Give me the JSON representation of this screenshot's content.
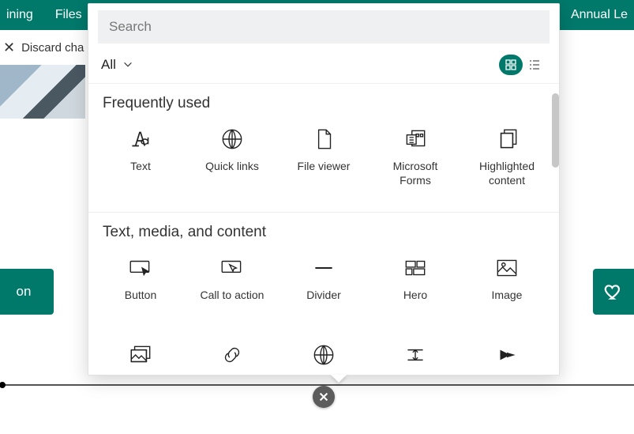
{
  "nav": {
    "items": [
      "ining",
      "Files"
    ],
    "right": "Annual Le"
  },
  "cmd": {
    "discard": "Discard cha"
  },
  "pill_left": "on",
  "panel": {
    "search_placeholder": "Search",
    "filter_label": "All",
    "sections": [
      {
        "title": "Frequently used",
        "items": [
          {
            "label": "Text",
            "icon": "text"
          },
          {
            "label": "Quick links",
            "icon": "globe"
          },
          {
            "label": "File viewer",
            "icon": "file"
          },
          {
            "label": "Microsoft Forms",
            "icon": "forms"
          },
          {
            "label": "Highlighted content",
            "icon": "stack"
          }
        ]
      },
      {
        "title": "Text, media, and content",
        "items": [
          {
            "label": "Button",
            "icon": "button"
          },
          {
            "label": "Call to action",
            "icon": "cta"
          },
          {
            "label": "Divider",
            "icon": "divider"
          },
          {
            "label": "Hero",
            "icon": "hero"
          },
          {
            "label": "Image",
            "icon": "image"
          }
        ]
      },
      {
        "title": "",
        "items": [
          {
            "label": "",
            "icon": "imgstack"
          },
          {
            "label": "",
            "icon": "link"
          },
          {
            "label": "",
            "icon": "globe"
          },
          {
            "label": "",
            "icon": "spacer"
          },
          {
            "label": "",
            "icon": "stream"
          }
        ]
      }
    ]
  }
}
